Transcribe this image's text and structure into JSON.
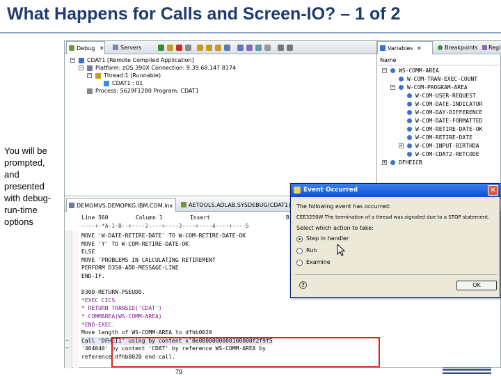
{
  "slide": {
    "title": "What Happens for Calls and Screen-IO? – 1 of 2",
    "side_text": "You will be prompted, and presented with debug-run-time options",
    "page_number": "79"
  },
  "debug_view": {
    "tabs": [
      {
        "label": "Debug",
        "active": true
      },
      {
        "label": "Servers",
        "active": false
      }
    ],
    "tree": [
      "CDAT1 [Remote Compiled Application]",
      "Platform: zOS 390X  Connection: 9.39.68.147 8174",
      "Thread:1 (Runnable)",
      "CDAT1 : 01",
      "Process: 5629F1280  Program: CDAT1"
    ]
  },
  "variables_view": {
    "tabs": [
      {
        "label": "Variables",
        "active": true
      },
      {
        "label": "Breakpoints",
        "active": false
      },
      {
        "label": "Regi",
        "active": false
      }
    ],
    "column_header": "Name",
    "items": [
      "WS-COMM-AREA",
      "W-COM-TRAN-EXEC-COUNT",
      "W-COM-PROGRAM-AREA",
      "W-COM-USER-REQUEST",
      "W-COM-DATE-INDICATOR",
      "W-COM-DAY-DIFFERENCE",
      "W-COM-DATE-FORMATTED",
      "W-COM-RETIRE-DATE-OK",
      "W-COM-RETIRE-DATE",
      "W-COM-INPUT-BIRTHDA",
      "W-COM-CDAT2-RETCODE",
      "DFHEICB"
    ]
  },
  "editor": {
    "tabs": [
      {
        "label": "DEMOMVS.DEMOPKG.IBM.COM.lnx",
        "active": true
      },
      {
        "label": "AETOOLS.ADLAB.SYSDEBUG(CDAT1).c",
        "active": false
      }
    ],
    "status": {
      "line": "Line 560",
      "column": "Column 1",
      "mode": "Insert",
      "extra": "B"
    },
    "ruler": "----+-*A-1-B--+----2----+----3----+----4----+----5",
    "lines": [
      {
        "text": "                 MOVE 'W-DATE-RETIRE-DATE' TO W-COM-RETIRE-DATE-OK",
        "marker": ""
      },
      {
        "text": "                 MOVE 'Y' TO W-COM-RETIRE-DATE-OK",
        "marker": ""
      },
      {
        "text": "              ELSE",
        "marker": ""
      },
      {
        "text": "                 MOVE 'PROBLEMS IN CALCULATING RETIREMENT",
        "marker": ""
      },
      {
        "text": "                 PERFORM D350-ADD-MESSAGE-LINE",
        "marker": ""
      },
      {
        "text": "              END-IF.",
        "marker": ""
      },
      {
        "text": "",
        "marker": ""
      },
      {
        "text": "         D300-RETURN-PSEUDO.",
        "marker": ""
      },
      {
        "text": "        *EXEC CICS",
        "marker": ""
      },
      {
        "text": "        *     RETURN TRANSID('CDAT')",
        "marker": ""
      },
      {
        "text": "        *     COMMAREA(WS-COMM-AREA)",
        "marker": ""
      },
      {
        "text": "        *END-EXEC.",
        "marker": ""
      },
      {
        "text": "              Move length of WS-COMM-AREA to dfhb0020",
        "marker": ""
      },
      {
        "text": "              Call 'DFHEI1' using by content x'0e0800000000100000f2f9f5",
        "marker": "arrow"
      },
      {
        "text": "              '404040' by content 'CDAT' by reference WS-COMM-AREA by",
        "marker": "dash"
      },
      {
        "text": "              reference dfhb0020 end-call.",
        "marker": ""
      }
    ]
  },
  "dialog": {
    "title": "Event Occurred",
    "message": "The following event has occurred:",
    "event_line": "CEE3250W The termination of a thread was signaled due to a STOP statement.",
    "prompt": "Select which action to take:",
    "options": [
      {
        "label": "Step in handler",
        "selected": true
      },
      {
        "label": "Run",
        "selected": false
      },
      {
        "label": "Examine",
        "selected": false
      }
    ],
    "ok_label": "OK"
  },
  "colors": {
    "title": "#1f3a6e",
    "highlight_box": "#e02020",
    "dialog_titlebar": "#0a50d0",
    "comment_text": "#7a1f8f",
    "string_text": "#2a3cc0"
  }
}
